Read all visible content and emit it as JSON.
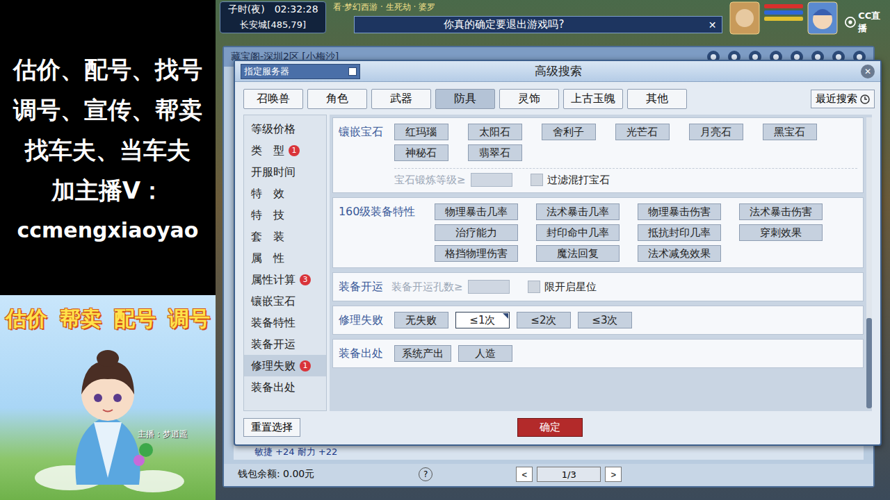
{
  "promo": {
    "lines": [
      "估价、配号、找号",
      "调号、宣传、帮卖",
      "找车夫、当车夫",
      "加主播V：",
      "ccmengxiaoyao"
    ]
  },
  "banner": {
    "slogans": [
      "估价",
      "帮卖",
      "配号",
      "调号"
    ],
    "host": "主播：梦逍遥"
  },
  "hud": {
    "period": "子时(夜)",
    "clock": "02:32:28",
    "location": "长安城[485,79]",
    "marquee": "看·梦幻西游 · 生死劫 · 婆罗",
    "stream_logo": "CC直播"
  },
  "alert": {
    "message": "你真的确定要退出游戏吗?",
    "close": "✕"
  },
  "window": {
    "title": "藏宝阁-深圳2区 [小梅沙]",
    "row_text": "敏捷 +24 耐力 +22",
    "wallet": "钱包余额: 0.00元",
    "help": "?",
    "prev": "<",
    "page": "1/3",
    "next": ">"
  },
  "dialog": {
    "server": "指定服务器",
    "title": "高级搜索",
    "close": "✕",
    "recent": "最近搜索",
    "tabs": [
      {
        "label": "召唤兽",
        "selected": false
      },
      {
        "label": "角色",
        "selected": false
      },
      {
        "label": "武器",
        "selected": false
      },
      {
        "label": "防具",
        "selected": true
      },
      {
        "label": "灵饰",
        "selected": false
      },
      {
        "label": "上古玉魄",
        "selected": false
      },
      {
        "label": "其他",
        "selected": false
      }
    ],
    "sidebar": [
      {
        "label": "等级价格",
        "badge": "",
        "selected": false
      },
      {
        "label": "类　型",
        "badge": "1",
        "selected": false
      },
      {
        "label": "开服时间",
        "badge": "",
        "selected": false
      },
      {
        "label": "特　效",
        "badge": "",
        "selected": false
      },
      {
        "label": "特　技",
        "badge": "",
        "selected": false
      },
      {
        "label": "套　装",
        "badge": "",
        "selected": false
      },
      {
        "label": "属　性",
        "badge": "",
        "selected": false
      },
      {
        "label": "属性计算",
        "badge": "3",
        "selected": false
      },
      {
        "label": "镶嵌宝石",
        "badge": "",
        "selected": false
      },
      {
        "label": "装备特性",
        "badge": "",
        "selected": false
      },
      {
        "label": "装备开运",
        "badge": "",
        "selected": false
      },
      {
        "label": "修理失败",
        "badge": "1",
        "selected": true
      },
      {
        "label": "装备出处",
        "badge": "",
        "selected": false
      }
    ],
    "sections": [
      {
        "kind": "gems",
        "label": "镶嵌宝石",
        "options": [
          {
            "label": "红玛瑙",
            "selected": false
          },
          {
            "label": "太阳石",
            "selected": false
          },
          {
            "label": "舍利子",
            "selected": false
          },
          {
            "label": "光芒石",
            "selected": false
          },
          {
            "label": "月亮石",
            "selected": false
          },
          {
            "label": "黑宝石",
            "selected": false
          },
          {
            "label": "神秘石",
            "selected": false
          },
          {
            "label": "翡翠石",
            "selected": false
          }
        ],
        "field_label": "宝石锻炼等级≥",
        "field_value": "",
        "filter": {
          "label": "过滤混打宝石",
          "checked": false
        }
      },
      {
        "kind": "features",
        "label": "160级装备特性",
        "options": [
          {
            "label": "物理暴击几率",
            "selected": false
          },
          {
            "label": "法术暴击几率",
            "selected": false
          },
          {
            "label": "物理暴击伤害",
            "selected": false
          },
          {
            "label": "法术暴击伤害",
            "selected": false
          },
          {
            "label": "治疗能力",
            "selected": false
          },
          {
            "label": "封印命中几率",
            "selected": false
          },
          {
            "label": "抵抗封印几率",
            "selected": false
          },
          {
            "label": "穿刺效果",
            "selected": false
          },
          {
            "label": "格挡物理伤害",
            "selected": false
          },
          {
            "label": "魔法回复",
            "selected": false
          },
          {
            "label": "法术减免效果",
            "selected": false
          }
        ]
      },
      {
        "kind": "opening",
        "label": "装备开运",
        "field_label": "装备开运孔数≥",
        "field_value": "",
        "filter": {
          "label": "限开启星位",
          "checked": false
        }
      },
      {
        "kind": "options",
        "label": "修理失败",
        "options": [
          {
            "label": "无失败",
            "selected": false
          },
          {
            "label": "≤1次",
            "selected": true
          },
          {
            "label": "≤2次",
            "selected": false
          },
          {
            "label": "≤3次",
            "selected": false
          }
        ]
      },
      {
        "kind": "options",
        "label": "装备出处",
        "options": [
          {
            "label": "系统产出",
            "selected": false
          },
          {
            "label": "人造",
            "selected": false
          }
        ]
      }
    ],
    "reset": "重置选择",
    "confirm": "确定"
  }
}
